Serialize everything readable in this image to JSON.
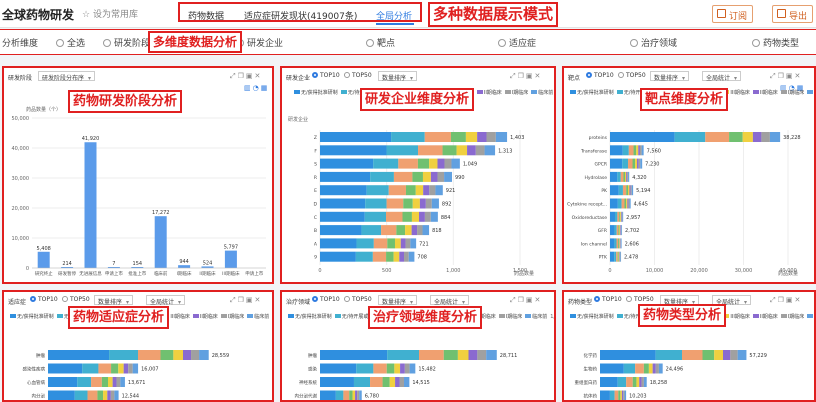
{
  "header": {
    "app_title": "全球药物研发",
    "favorite": "设为常用库",
    "tabs": [
      {
        "label": "药物数据"
      },
      {
        "label": "适应症研发现状(419007条)"
      },
      {
        "label": "全局分析"
      }
    ],
    "subscribe": "订阅",
    "export": "导出"
  },
  "annotations": {
    "modes": "多种数据展示模式",
    "dimensions": "多维度数据分析",
    "panel_titles": [
      "药物研发阶段分析",
      "研发企业维度分析",
      "靶点维度分析",
      "药物适应症分析",
      "治疗领域维度分析",
      "药物类型分析"
    ]
  },
  "filter": {
    "label": "分析维度",
    "options": [
      "全选",
      "研发阶段",
      "研发企业",
      "靶点",
      "适应症",
      "治疗领域",
      "药物类型"
    ]
  },
  "panels": [
    {
      "title": "研发阶段",
      "select": "研发阶段分布序",
      "sub": "药品数量（个）"
    },
    {
      "title": "研发企业",
      "radio": [
        "TOP10",
        "TOP50"
      ],
      "select1": "数量排序",
      "select2": "全局统计",
      "sub": "研发企业",
      "axis_title": "药品数量",
      "page": "1/2"
    },
    {
      "title": "靶点",
      "radio": [
        "TOP10",
        "TOP50"
      ],
      "select1": "数量排序",
      "select2": "全局统计",
      "axis_title": "药品数量",
      "page": "1/2"
    },
    {
      "title": "适应症",
      "radio": [
        "TOP10",
        "TOP50"
      ],
      "select1": "数量排序",
      "select2": "全局统计",
      "page": "1/2"
    },
    {
      "title": "治疗领域",
      "radio": [
        "TOP10",
        "TOP50"
      ],
      "select1": "数量排序",
      "select2": "全局统计",
      "page": "1/2"
    },
    {
      "title": "药物类型",
      "radio": [
        "TOP10",
        "TOP50"
      ],
      "select1": "数量排序",
      "select2": "全局统计",
      "page": "1/2"
    }
  ],
  "legend": [
    {
      "label": "无/获得批准研制",
      "color": "#2f8fdf"
    },
    {
      "label": "无/待开展或批准",
      "color": "#40b0d0"
    },
    {
      "label": "批准上市",
      "color": "#f0a070"
    },
    {
      "label": "申请上市",
      "color": "#70c070"
    },
    {
      "label": "III期临床",
      "color": "#f0d040"
    },
    {
      "label": "II期临床",
      "color": "#8a6ad0"
    },
    {
      "label": "I期临床",
      "color": "#a0a0a0"
    },
    {
      "label": "临床前",
      "color": "#60a0e0"
    }
  ],
  "chart_data": [
    {
      "type": "bar",
      "categories": [
        "研究终止",
        "研发暂停",
        "无进展信息",
        "申请上市",
        "批准上市",
        "临床前",
        "I期临床",
        "II期临床",
        "III期临床",
        "申请上市"
      ],
      "values": [
        5408,
        214,
        41920,
        7,
        154,
        17272,
        944,
        524,
        5797,
        0
      ],
      "ylim": [
        0,
        50000
      ],
      "yticks": [
        0,
        10000,
        20000,
        30000,
        40000,
        50000
      ],
      "value_labels": [
        "5,408",
        "214",
        "41,920",
        "7",
        "154",
        "17,272",
        "944",
        "524",
        "5,797",
        ""
      ]
    },
    {
      "type": "bar",
      "orientation": "horizontal",
      "stacked": true,
      "categories": [
        "Z",
        "F",
        "S",
        "R",
        "E",
        "D",
        "C",
        "B",
        "A",
        "9"
      ],
      "totals": [
        1403,
        1313,
        1049,
        990,
        921,
        892,
        884,
        818,
        721,
        708
      ],
      "value_labels": [
        "1,403",
        "1,313",
        "1,049",
        "990",
        "921",
        "892",
        "884",
        "818",
        "721",
        "708"
      ],
      "xlim": [
        0,
        1500
      ],
      "xticks": [
        "0",
        "500",
        "1,000",
        "1,500"
      ]
    },
    {
      "type": "bar",
      "orientation": "horizontal",
      "stacked": true,
      "categories": [
        "proteins",
        "Transferase",
        "GPCR",
        "Hydrolase",
        "PK",
        "Cytokine recept...",
        "Oxidoreductase",
        "GFR",
        "Ion channel",
        "PTK"
      ],
      "totals": [
        38228,
        7560,
        7230,
        4320,
        5194,
        4645,
        2957,
        2702,
        2606,
        2478
      ],
      "value_labels": [
        "38,228",
        "7,560",
        "7,230",
        "4,320",
        "5,194",
        "4,645",
        "2,957",
        "2,702",
        "2,606",
        "2,478"
      ],
      "xlim": [
        0,
        40000
      ],
      "xticks": [
        "0",
        "10,000",
        "20,000",
        "30,000",
        "40,000"
      ]
    },
    {
      "type": "bar",
      "orientation": "horizontal",
      "stacked": true,
      "categories": [
        "肿瘤",
        "感染性疾病",
        "心血管病",
        "内分泌"
      ],
      "totals": [
        28559,
        16007,
        13671,
        12544
      ],
      "value_labels": [
        "28,559",
        "16,007",
        "13,671",
        "12,544"
      ]
    },
    {
      "type": "bar",
      "orientation": "horizontal",
      "stacked": true,
      "categories": [
        "肿瘤",
        "感染",
        "神经系统",
        "内分泌代谢"
      ],
      "totals": [
        28711,
        15482,
        14515,
        6780
      ],
      "value_labels": [
        "28,711",
        "15,482",
        "14,515",
        "6,780"
      ]
    },
    {
      "type": "bar",
      "orientation": "horizontal",
      "stacked": true,
      "categories": [
        "化学药",
        "生物药",
        "重组蛋白药",
        "抗体药"
      ],
      "totals": [
        57229,
        24496,
        18258,
        10203
      ],
      "value_labels": [
        "57,229",
        "24,496",
        "18,258",
        "10,203"
      ]
    }
  ]
}
